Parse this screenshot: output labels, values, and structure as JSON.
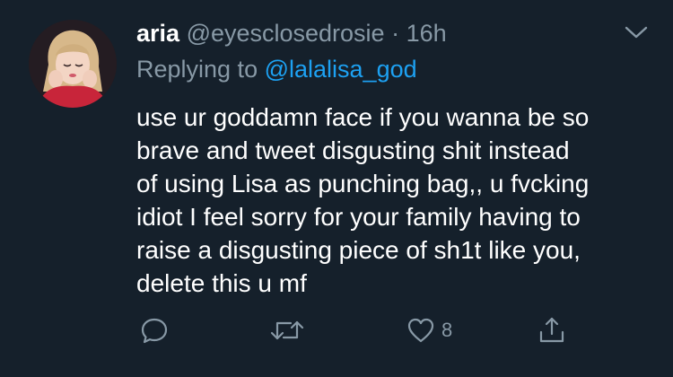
{
  "tweet": {
    "display_name": "aria",
    "handle": "@eyesclosedrosie",
    "separator": "·",
    "time": "16h",
    "replying_prefix": "Replying to",
    "replying_to": "@lalalisa_god",
    "body_lines": [
      "use ur goddamn face if you wanna be so",
      "brave and tweet disgusting shit instead",
      "of using Lisa as punching bag,, u fvcking",
      "idiot I feel sorry for your family having to",
      "raise a disgusting piece of sh1t like you,",
      "delete this u mf"
    ],
    "like_count": "8"
  },
  "icons": {
    "more": "chevron-down-icon",
    "reply": "reply-icon",
    "retweet": "retweet-icon",
    "like": "heart-icon",
    "share": "share-icon"
  },
  "colors": {
    "background": "#15202b",
    "text": "#ffffff",
    "secondary": "#8899a6",
    "link": "#1da1f2"
  }
}
